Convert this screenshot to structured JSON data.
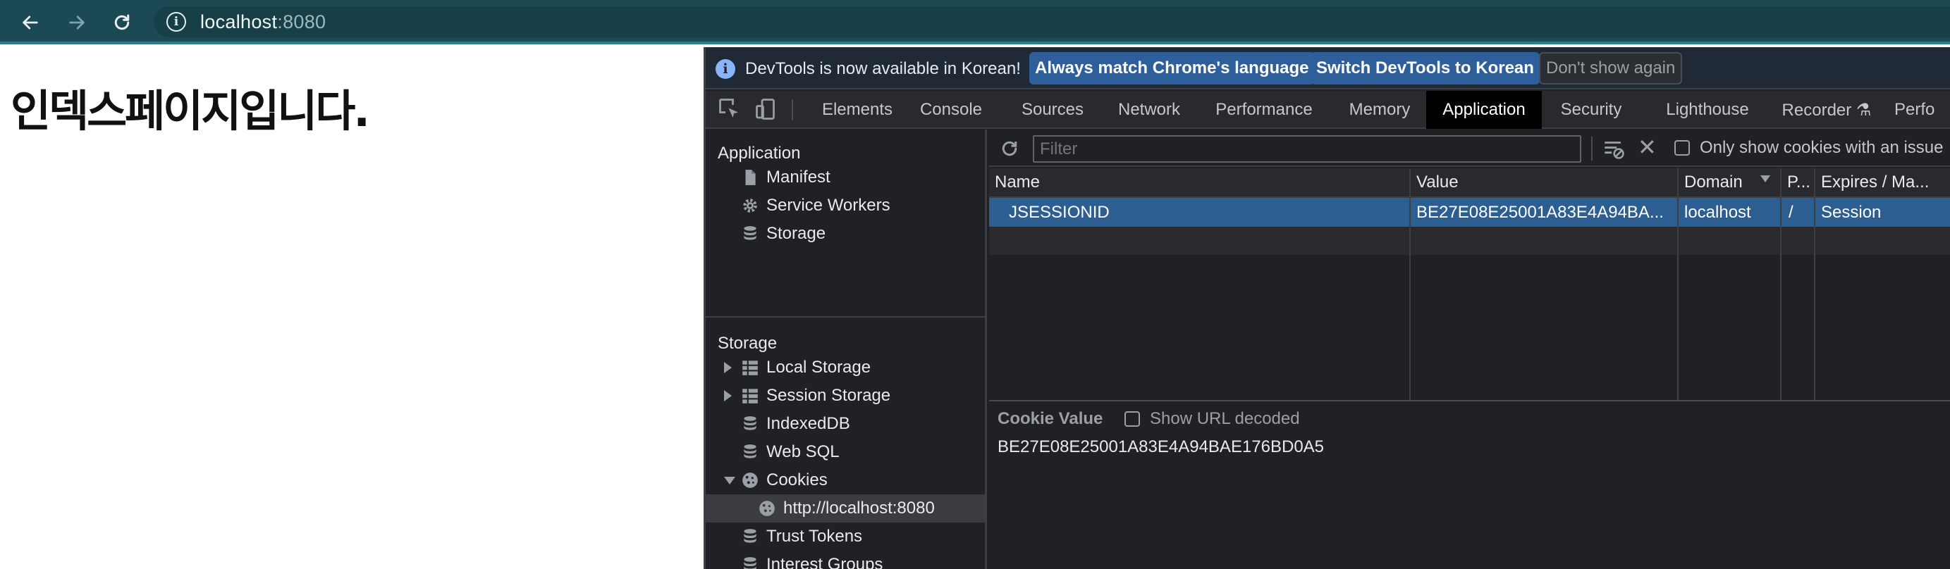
{
  "browser": {
    "back_icon": "arrow-left-icon",
    "forward_icon": "arrow-right-icon",
    "reload_icon": "reload-icon",
    "url_host": "localhost",
    "url_port": ":8080"
  },
  "page": {
    "heading": "인덱스페이지입니다."
  },
  "devtools": {
    "infobar": {
      "message": "DevTools is now available in Korean!",
      "btn_match": "Always match Chrome's language",
      "btn_switch": "Switch DevTools to Korean",
      "btn_dismiss": "Don't show again"
    },
    "tabs": [
      "Elements",
      "Console",
      "Sources",
      "Network",
      "Performance",
      "Memory",
      "Application",
      "Security",
      "Lighthouse",
      "Recorder ⚗",
      "Perfo"
    ],
    "active_tab": "Application",
    "sidebar": {
      "app_header": "Application",
      "app_items": [
        "Manifest",
        "Service Workers",
        "Storage"
      ],
      "storage_header": "Storage",
      "storage_items": [
        "Local Storage",
        "Session Storage",
        "IndexedDB",
        "Web SQL",
        "Cookies",
        "http://localhost:8080",
        "Trust Tokens",
        "Interest Groups"
      ]
    },
    "filter": {
      "placeholder": "Filter",
      "only_issues_label": "Only show cookies with an issue"
    },
    "table": {
      "headers": [
        "Name",
        "Value",
        "Domain",
        "P...",
        "Expires / Ma..."
      ],
      "rows": [
        {
          "name": "JSESSIONID",
          "value": "BE27E08E25001A83E4A94BA...",
          "domain": "localhost",
          "path": "/",
          "expires": "Session"
        }
      ]
    },
    "cookie_value": {
      "label": "Cookie Value",
      "show_decoded": "Show URL decoded",
      "value": "BE27E08E25001A83E4A94BAE176BD0A5"
    },
    "colors": {
      "selection": "#2c5e91",
      "toolbar": "#1b4a54",
      "primary_button": "#2f5f9a"
    }
  }
}
